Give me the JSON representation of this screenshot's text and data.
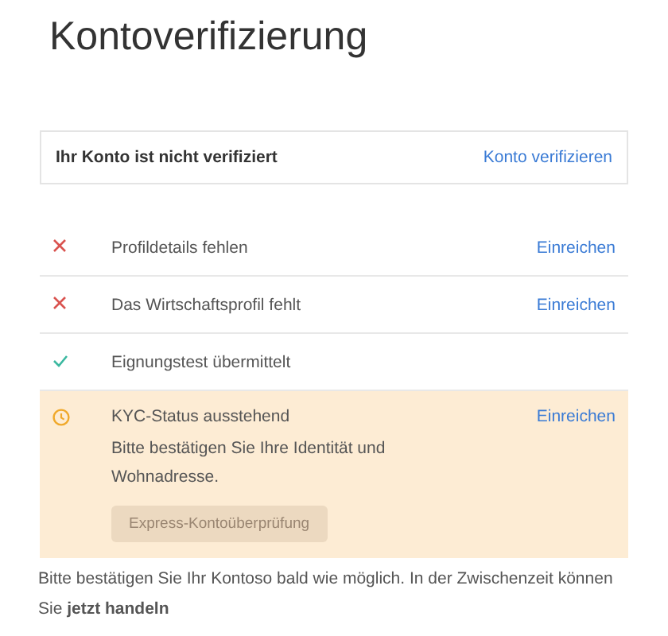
{
  "title": "Kontoverifizierung",
  "banner": {
    "text": "Ihr Konto ist nicht verifiziert",
    "action": "Konto verifizieren"
  },
  "steps": [
    {
      "kind": "missing",
      "label": "Profildetails fehlen",
      "action": "Einreichen"
    },
    {
      "kind": "missing",
      "label": "Das Wirtschaftsprofil fehlt",
      "action": "Einreichen"
    },
    {
      "kind": "done",
      "label": "Eignungstest übermittelt"
    },
    {
      "kind": "pending",
      "label": "KYC-Status ausstehend",
      "description": "Bitte bestätigen Sie Ihre Identität und Wohnadresse.",
      "action": "Einreichen",
      "button": {
        "label": "Express-Kontoüberprüfung",
        "disabled": true
      }
    }
  ],
  "footer": "Bitte bestätigen Sie Ihr Kontoso bald wie möglich. In der Zwischenzeit können Sie **jetzt handeln**"
}
